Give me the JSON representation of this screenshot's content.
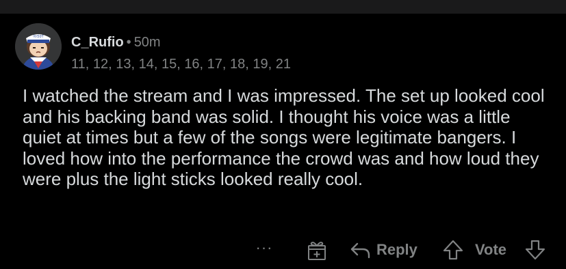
{
  "comment": {
    "username": "C_Rufio",
    "separator": "•",
    "time": "50m",
    "flair": "11, 12, 13, 14, 15, 16, 17, 18, 19, 21",
    "avatar_hat_text": "아리0T",
    "body": "I watched the stream and I was impressed. The set up looked cool and his backing band was solid. I thought his voice was a little quiet at times but a few of the songs were legitimate bangers. I loved how into the performance the crowd was and how loud they were plus the light sticks looked really cool."
  },
  "actions": {
    "more_label": "···",
    "award_icon": "gift-plus-icon",
    "reply_label": "Reply",
    "vote_label": "Vote",
    "upvote_icon": "arrow-up-icon",
    "downvote_icon": "arrow-down-icon"
  },
  "colors": {
    "background": "#000000",
    "top_strip": "#1a1a1b",
    "text_primary": "#d7dadc",
    "text_muted": "#818384"
  }
}
